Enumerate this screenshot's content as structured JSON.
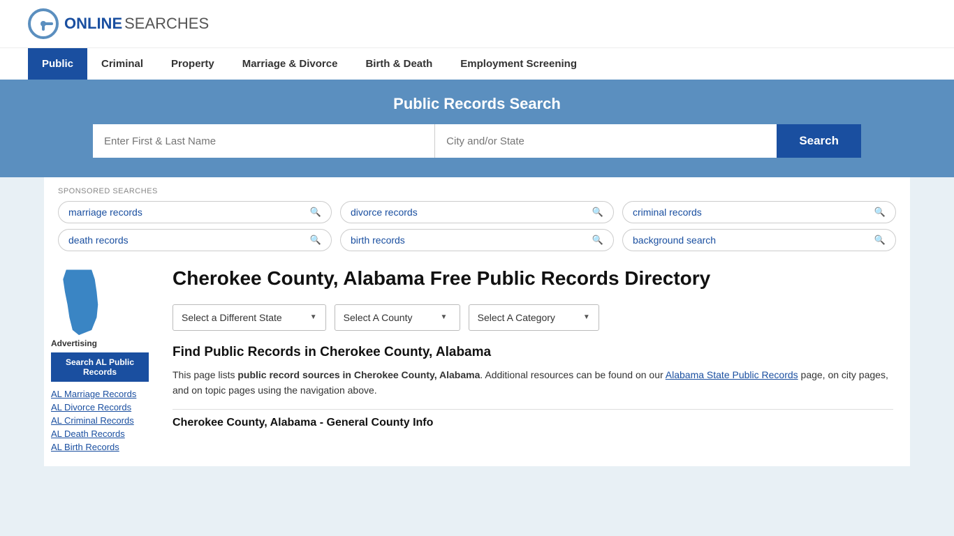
{
  "header": {
    "logo_online": "ONLINE",
    "logo_searches": "SEARCHES"
  },
  "nav": {
    "items": [
      {
        "label": "Public",
        "active": true
      },
      {
        "label": "Criminal",
        "active": false
      },
      {
        "label": "Property",
        "active": false
      },
      {
        "label": "Marriage & Divorce",
        "active": false
      },
      {
        "label": "Birth & Death",
        "active": false
      },
      {
        "label": "Employment Screening",
        "active": false
      }
    ]
  },
  "search_banner": {
    "title": "Public Records Search",
    "name_placeholder": "Enter First & Last Name",
    "location_placeholder": "City and/or State",
    "search_button": "Search"
  },
  "sponsored": {
    "label": "SPONSORED SEARCHES",
    "links": [
      {
        "text": "marriage records"
      },
      {
        "text": "divorce records"
      },
      {
        "text": "criminal records"
      },
      {
        "text": "death records"
      },
      {
        "text": "birth records"
      },
      {
        "text": "background search"
      }
    ]
  },
  "sidebar": {
    "advertising_label": "Advertising",
    "ad_button": "Search AL Public Records",
    "links": [
      {
        "text": "AL Marriage Records"
      },
      {
        "text": "AL Divorce Records"
      },
      {
        "text": "AL Criminal Records"
      },
      {
        "text": "AL Death Records"
      },
      {
        "text": "AL Birth Records"
      }
    ]
  },
  "main": {
    "page_title": "Cherokee County, Alabama Free Public Records Directory",
    "dropdowns": {
      "state": "Select a Different State",
      "county": "Select A County",
      "category": "Select A Category"
    },
    "find_heading": "Find Public Records in Cherokee County, Alabama",
    "find_description_1": "This page lists ",
    "find_description_bold": "public record sources in Cherokee County, Alabama",
    "find_description_2": ". Additional resources can be found on our ",
    "find_link_text": "Alabama State Public Records",
    "find_description_3": " page, on city pages, and on topic pages using the navigation above.",
    "county_info_heading": "Cherokee County, Alabama - General County Info"
  }
}
